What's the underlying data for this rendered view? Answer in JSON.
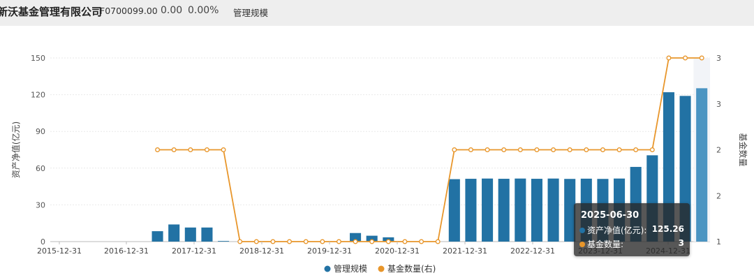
{
  "header": {
    "company": "新沃基金管理有限公司",
    "code": "F0700099.00",
    "value": "0.00",
    "change_pct": "0.00%",
    "tab": "管理规模"
  },
  "colors": {
    "bar": "#2272a4",
    "bar_highlight": "#4a94c2",
    "line": "#e8962b"
  },
  "chart_data": {
    "type": "bar",
    "ylabel": "资产净值(亿元)",
    "y2label": "基金数量",
    "ylim": [
      0,
      150
    ],
    "yticks": [
      0,
      30,
      60,
      90,
      120,
      150
    ],
    "y2ticks_labels": [
      "1",
      "2",
      "2",
      "3",
      "3"
    ],
    "y2lim": [
      1,
      3
    ],
    "xtick_labels": [
      "2015-12-31",
      "2016-12-31",
      "2017-12-31",
      "2018-12-31",
      "2019-12-31",
      "2020-12-31",
      "2021-12-31",
      "2022-12-31",
      "2023-12-31",
      "2024-12-31"
    ],
    "legend": [
      "管理规模",
      "基金数量(右)"
    ],
    "legend_position": "bottom",
    "grid": true,
    "bar_values": [
      0,
      0,
      0,
      0,
      0,
      0,
      8.5,
      14,
      11.5,
      11.5,
      0.5,
      0,
      0,
      0,
      0,
      0,
      0,
      0,
      7,
      4.8,
      3.5,
      0,
      0,
      0,
      51,
      51.3,
      51.5,
      51.3,
      51.5,
      51.3,
      51.5,
      51.2,
      51.4,
      51.2,
      51.5,
      61,
      70.5,
      122,
      119,
      125.26
    ],
    "line_values": [
      null,
      null,
      null,
      null,
      null,
      null,
      2,
      2,
      2,
      2,
      2,
      1,
      1,
      1,
      1,
      1,
      1,
      1,
      1,
      1,
      1,
      1,
      1,
      1,
      2,
      2,
      2,
      2,
      2,
      2,
      2,
      2,
      2,
      2,
      2,
      2,
      2,
      3,
      3,
      3
    ],
    "highlight_index": 39
  },
  "tooltip": {
    "date": "2025-06-30",
    "row1_label": "资产净值(亿元):",
    "row1_value": "125.26",
    "row2_label": "基金数量:",
    "row2_value": "3"
  }
}
